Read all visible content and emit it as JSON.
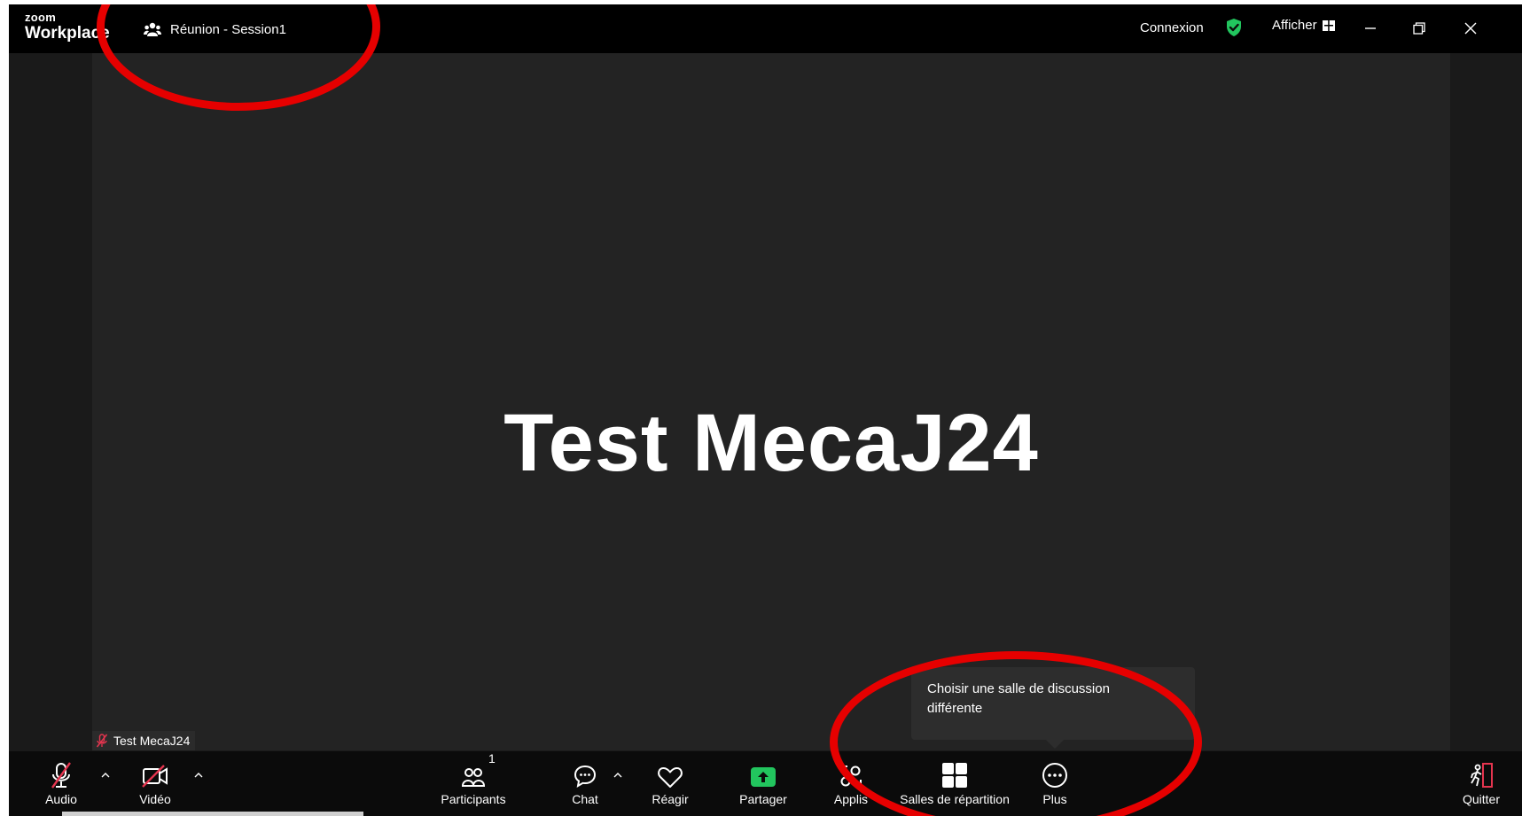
{
  "app": {
    "logo_small": "zoom",
    "logo_big": "Workplace"
  },
  "titlebar": {
    "session_title": "Réunion - Session1",
    "connection_label": "Connexion",
    "view_label": "Afficher"
  },
  "stage": {
    "shared_text": "Test MecaJ24"
  },
  "participant": {
    "name": "Test MecaJ24"
  },
  "tooltip": {
    "text_line1": "Choisir une salle de discussion",
    "text_line2": "différente"
  },
  "toolbar": {
    "audio_label": "Audio",
    "video_label": "Vidéo",
    "participants_label": "Participants",
    "participants_count": "1",
    "chat_label": "Chat",
    "react_label": "Réagir",
    "share_label": "Partager",
    "apps_label": "Applis",
    "breakout_label": "Salles de répartition",
    "more_label": "Plus",
    "leave_label": "Quitter"
  },
  "colors": {
    "accent_green": "#22c55e",
    "muted_red": "#e5354f",
    "annotation_red": "#e60000",
    "background": "#232323"
  }
}
